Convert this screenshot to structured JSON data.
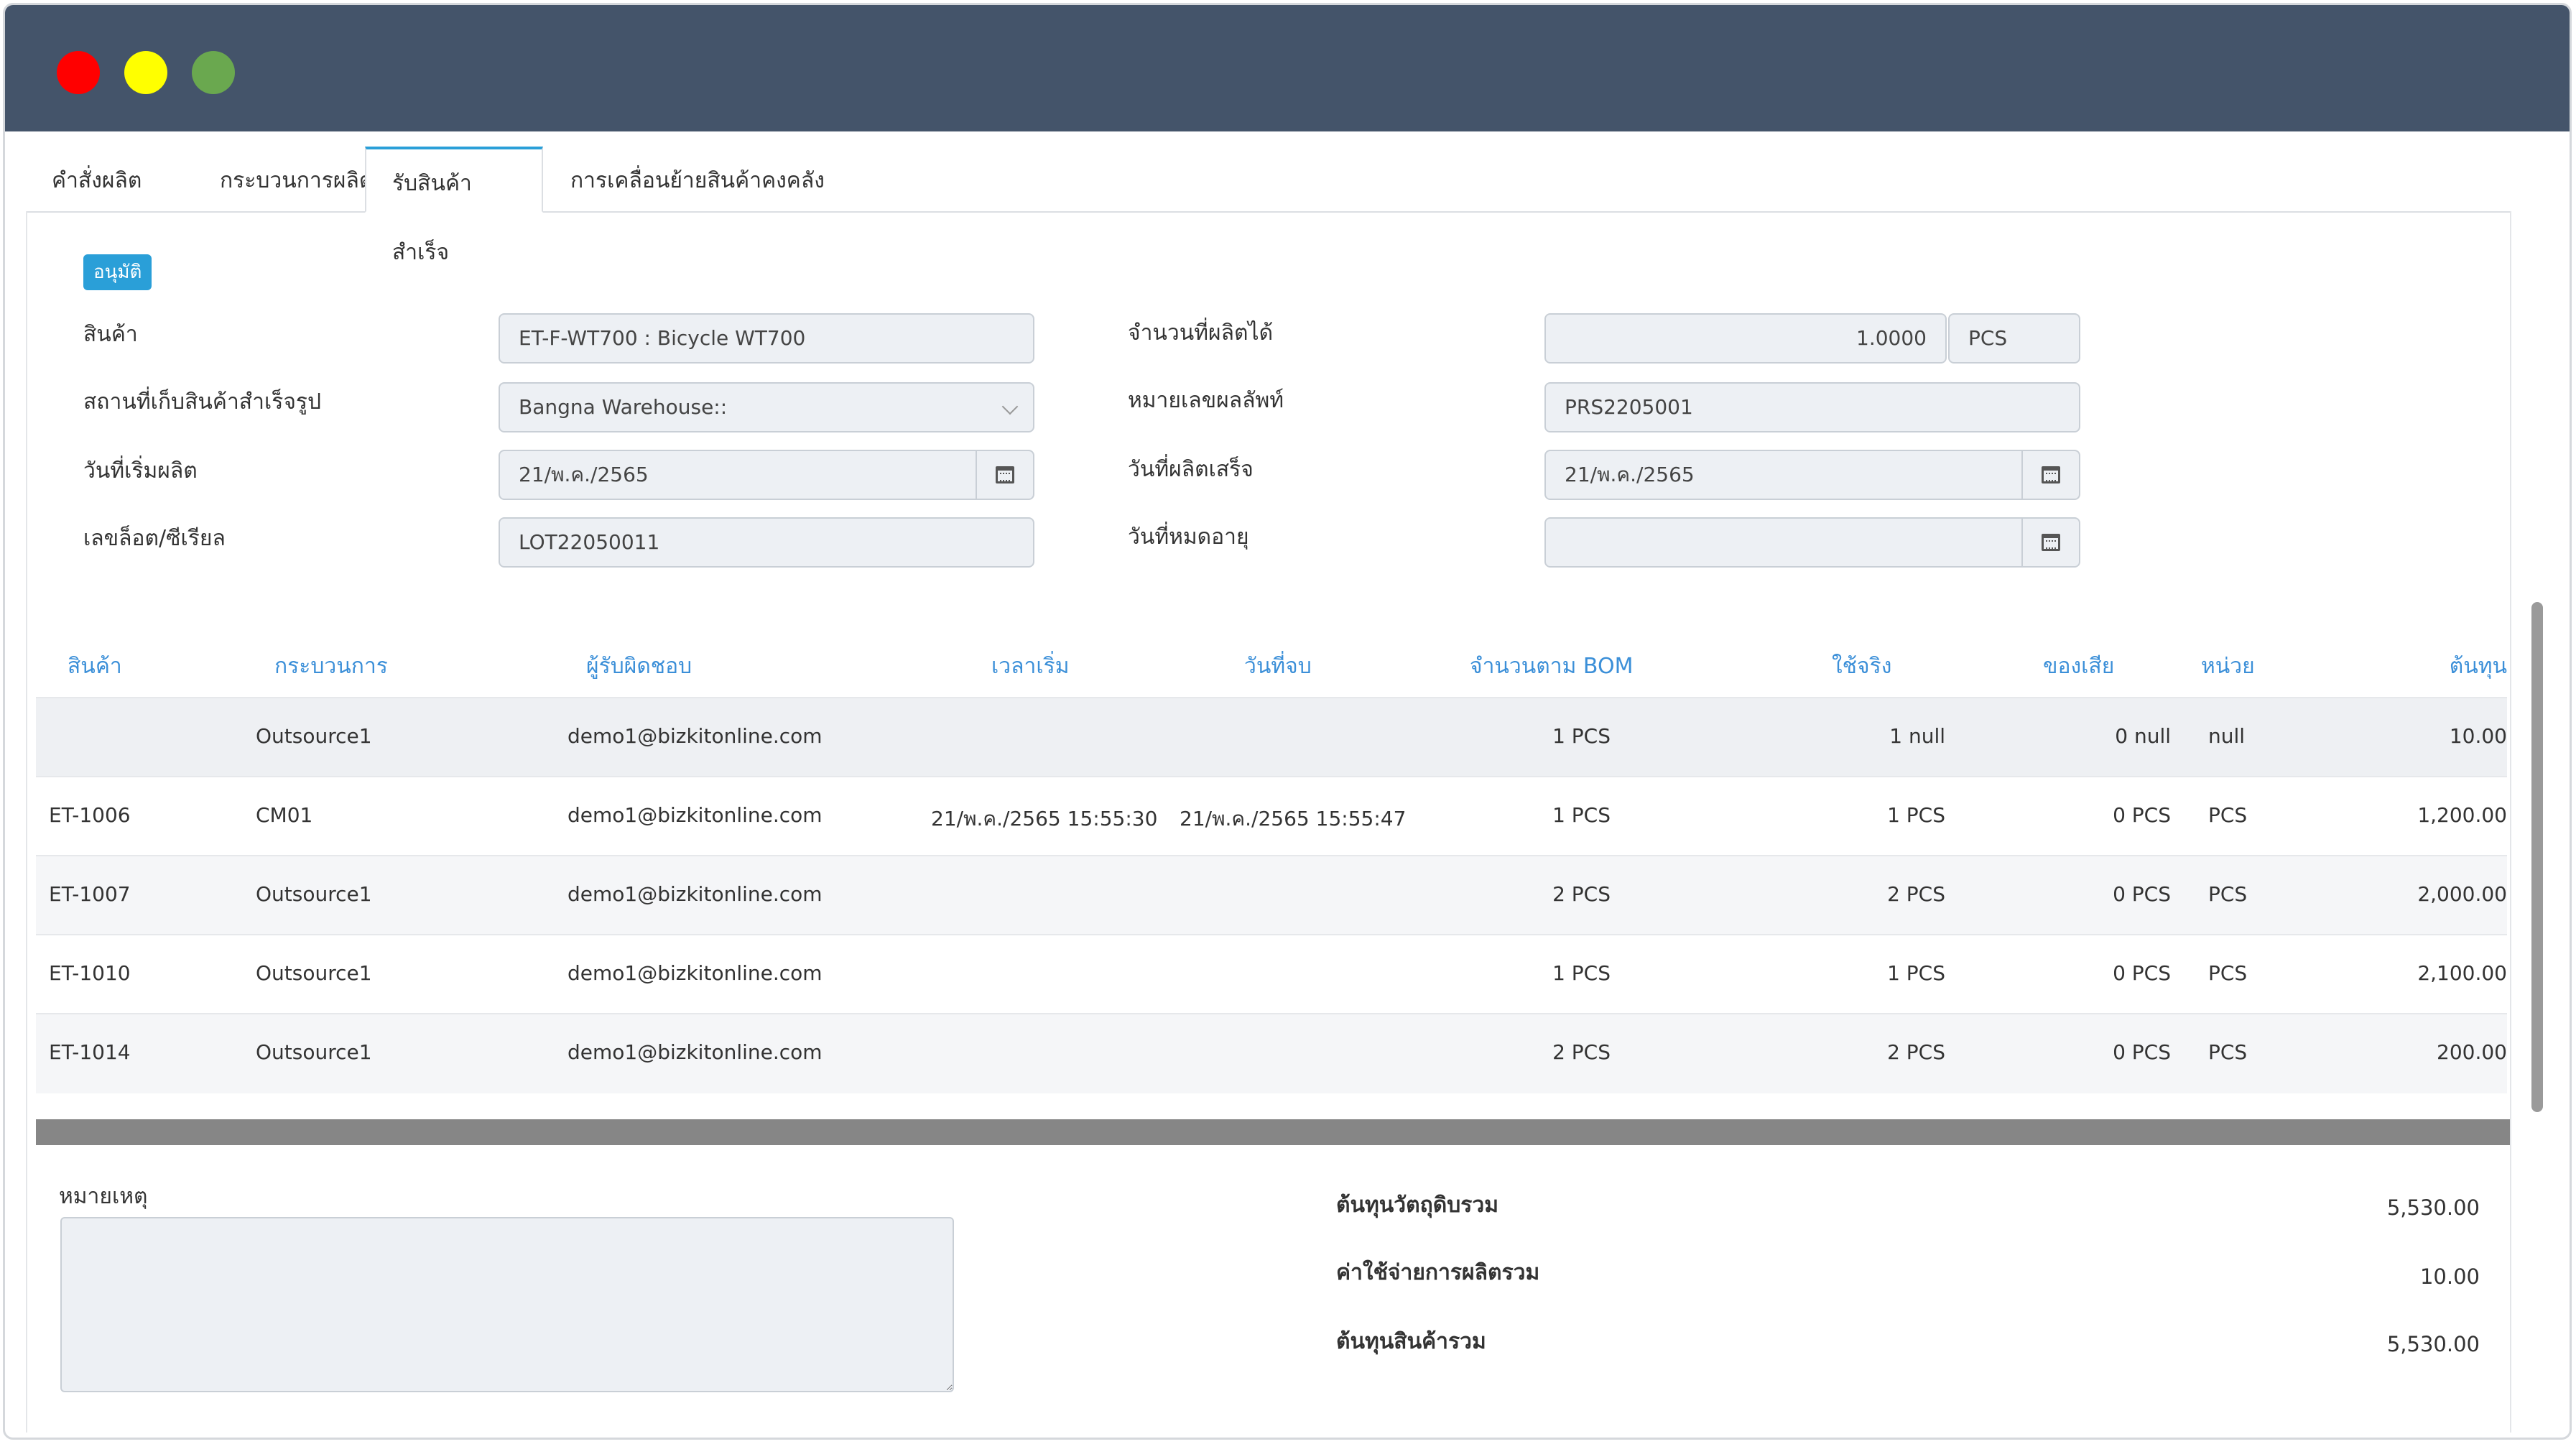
{
  "window": {
    "traffic_lights": [
      "#ff0000",
      "#ffff00",
      "#6aa84f"
    ]
  },
  "tabs": [
    {
      "label": "คำสั่งผลิต"
    },
    {
      "label": "กระบวนการผลิต"
    },
    {
      "label": "รับสินค้าสำเร็จ"
    },
    {
      "label": "การเคลื่อนย้ายสินค้าคงคลัง"
    }
  ],
  "status_badge": "อนุมัติ",
  "form": {
    "product": {
      "label": "สินค้า",
      "value": "ET-F-WT700 : Bicycle WT700"
    },
    "warehouse": {
      "label": "สถานที่เก็บสินค้าสำเร็จรูป",
      "value": "Bangna Warehouse::"
    },
    "start_date": {
      "label": "วันที่เริ่มผลิต",
      "value": "21/พ.ค./2565"
    },
    "lot": {
      "label": "เลขล็อต/ซีเรียล",
      "value": "LOT22050011"
    },
    "qty": {
      "label": "จำนวนที่ผลิตได้",
      "value": "1.0000",
      "unit": "PCS"
    },
    "product_no": {
      "label": "หมายเลขผลลัพท์",
      "value": "PRS2205001"
    },
    "finish_date": {
      "label": "วันที่ผลิตเสร็จ",
      "value": "21/พ.ค./2565"
    },
    "expiry_date": {
      "label": "วันที่หมดอายุ",
      "value": ""
    }
  },
  "table": {
    "headers": [
      "สินค้า",
      "กระบวนการ",
      "ผู้รับผิดชอบ",
      "เวลาเริ่ม",
      "วันที่จบ",
      "จำนวนตาม BOM",
      "ใช้จริง",
      "ของเสีย",
      "หน่วย",
      "ต้นทุน"
    ],
    "rows": [
      [
        "",
        "Outsource1",
        "demo1@bizkitonline.com",
        "",
        "",
        "1 PCS",
        "1 null",
        "0 null",
        "null",
        "10.00"
      ],
      [
        "ET-1006",
        "CM01",
        "demo1@bizkitonline.com",
        "21/พ.ค./2565 15:55:30",
        "21/พ.ค./2565 15:55:47",
        "1 PCS",
        "1 PCS",
        "0 PCS",
        "PCS",
        "1,200.00"
      ],
      [
        "ET-1007",
        "Outsource1",
        "demo1@bizkitonline.com",
        "",
        "",
        "2 PCS",
        "2 PCS",
        "0 PCS",
        "PCS",
        "2,000.00"
      ],
      [
        "ET-1010",
        "Outsource1",
        "demo1@bizkitonline.com",
        "",
        "",
        "1 PCS",
        "1 PCS",
        "0 PCS",
        "PCS",
        "2,100.00"
      ],
      [
        "ET-1014",
        "Outsource1",
        "demo1@bizkitonline.com",
        "",
        "",
        "2 PCS",
        "2 PCS",
        "0 PCS",
        "PCS",
        "200.00"
      ]
    ]
  },
  "remark": {
    "label": "หมายเหตุ",
    "value": ""
  },
  "summary": [
    {
      "label": "ต้นทุนวัตถุดิบรวม",
      "value": "5,530.00"
    },
    {
      "label": "ค่าใช้จ่ายการผลิตรวม",
      "value": "10.00"
    },
    {
      "label": "ต้นทุนสินค้ารวม",
      "value": "5,530.00"
    }
  ]
}
